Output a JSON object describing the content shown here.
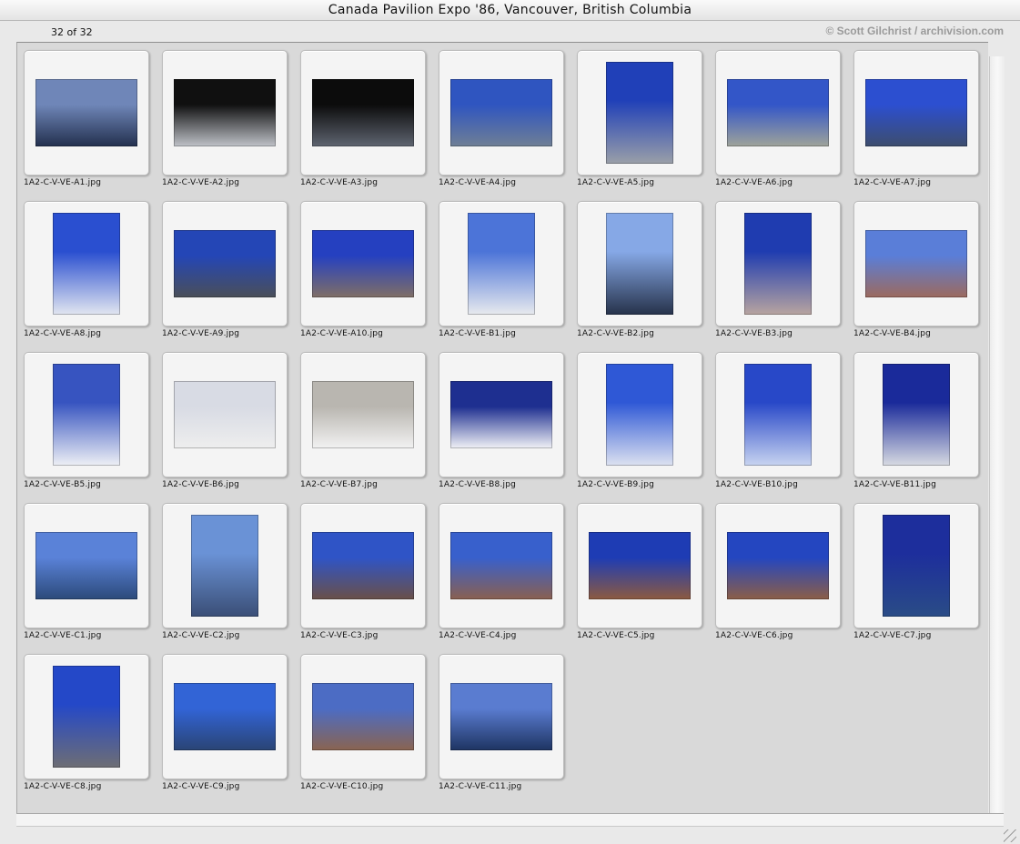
{
  "window": {
    "title": "Canada Pavilion Expo '86, Vancouver, British Columbia"
  },
  "header": {
    "count": "32 of 32",
    "copyright": "© Scott Gilchrist / archivision.com"
  },
  "thumbnails": [
    {
      "filename": "1A2-C-V-VE-A1.jpg",
      "orientation": "landscape",
      "top": "#6f86b8",
      "bottom": "#23304e"
    },
    {
      "filename": "1A2-C-V-VE-A2.jpg",
      "orientation": "landscape",
      "top": "#101010",
      "bottom": "#bfc2c8"
    },
    {
      "filename": "1A2-C-V-VE-A3.jpg",
      "orientation": "landscape",
      "top": "#0c0c0c",
      "bottom": "#5e6470"
    },
    {
      "filename": "1A2-C-V-VE-A4.jpg",
      "orientation": "landscape",
      "top": "#2f55c0",
      "bottom": "#6f7f95"
    },
    {
      "filename": "1A2-C-V-VE-A5.jpg",
      "orientation": "portrait",
      "top": "#2040b8",
      "bottom": "#9a9fa8"
    },
    {
      "filename": "1A2-C-V-VE-A6.jpg",
      "orientation": "landscape",
      "top": "#3356c8",
      "bottom": "#9fa39a"
    },
    {
      "filename": "1A2-C-V-VE-A7.jpg",
      "orientation": "landscape",
      "top": "#2c4fd0",
      "bottom": "#3d4d6d"
    },
    {
      "filename": "1A2-C-V-VE-A8.jpg",
      "orientation": "portrait",
      "top": "#2a4fd0",
      "bottom": "#e2e6f0"
    },
    {
      "filename": "1A2-C-V-VE-A9.jpg",
      "orientation": "landscape",
      "top": "#2446b6",
      "bottom": "#4a4f58"
    },
    {
      "filename": "1A2-C-V-VE-A10.jpg",
      "orientation": "landscape",
      "top": "#2540c0",
      "bottom": "#806f66"
    },
    {
      "filename": "1A2-C-V-VE-B1.jpg",
      "orientation": "portrait",
      "top": "#4c74d8",
      "bottom": "#e8eaee"
    },
    {
      "filename": "1A2-C-V-VE-B2.jpg",
      "orientation": "portrait",
      "top": "#86a8e6",
      "bottom": "#26324a"
    },
    {
      "filename": "1A2-C-V-VE-B3.jpg",
      "orientation": "portrait",
      "top": "#1f3cb0",
      "bottom": "#b8a4a0"
    },
    {
      "filename": "1A2-C-V-VE-B4.jpg",
      "orientation": "landscape",
      "top": "#5a7ed8",
      "bottom": "#9c6a5e"
    },
    {
      "filename": "1A2-C-V-VE-B5.jpg",
      "orientation": "portrait",
      "top": "#3754c0",
      "bottom": "#eef0f5"
    },
    {
      "filename": "1A2-C-V-VE-B6.jpg",
      "orientation": "landscape",
      "top": "#d8dbe4",
      "bottom": "#eeeeee"
    },
    {
      "filename": "1A2-C-V-VE-B7.jpg",
      "orientation": "landscape",
      "top": "#b9b6b0",
      "bottom": "#f2f2f2"
    },
    {
      "filename": "1A2-C-V-VE-B8.jpg",
      "orientation": "landscape",
      "top": "#1e2f90",
      "bottom": "#f0f1f6"
    },
    {
      "filename": "1A2-C-V-VE-B9.jpg",
      "orientation": "portrait",
      "top": "#2f58d6",
      "bottom": "#dde2f0"
    },
    {
      "filename": "1A2-C-V-VE-B10.jpg",
      "orientation": "portrait",
      "top": "#2848c8",
      "bottom": "#c8d4f0"
    },
    {
      "filename": "1A2-C-V-VE-B11.jpg",
      "orientation": "portrait",
      "top": "#1a2a9a",
      "bottom": "#d8dbe2"
    },
    {
      "filename": "1A2-C-V-VE-C1.jpg",
      "orientation": "landscape",
      "top": "#5a82d8",
      "bottom": "#2c4a7a"
    },
    {
      "filename": "1A2-C-V-VE-C2.jpg",
      "orientation": "portrait",
      "top": "#6a92d6",
      "bottom": "#3a4e76"
    },
    {
      "filename": "1A2-C-V-VE-C3.jpg",
      "orientation": "landscape",
      "top": "#2f54c6",
      "bottom": "#6a5048"
    },
    {
      "filename": "1A2-C-V-VE-C4.jpg",
      "orientation": "landscape",
      "top": "#3860cc",
      "bottom": "#8a6050"
    },
    {
      "filename": "1A2-C-V-VE-C5.jpg",
      "orientation": "landscape",
      "top": "#1e3cb4",
      "bottom": "#8c5a40"
    },
    {
      "filename": "1A2-C-V-VE-C6.jpg",
      "orientation": "landscape",
      "top": "#2446c0",
      "bottom": "#8c5e46"
    },
    {
      "filename": "1A2-C-V-VE-C7.jpg",
      "orientation": "portrait",
      "top": "#1d2e9c",
      "bottom": "#2a4c86"
    },
    {
      "filename": "1A2-C-V-VE-C8.jpg",
      "orientation": "portrait",
      "top": "#2448c8",
      "bottom": "#6e6e74"
    },
    {
      "filename": "1A2-C-V-VE-C9.jpg",
      "orientation": "landscape",
      "top": "#3264d6",
      "bottom": "#2a4474"
    },
    {
      "filename": "1A2-C-V-VE-C10.jpg",
      "orientation": "landscape",
      "top": "#4c6cc4",
      "bottom": "#8a6450"
    },
    {
      "filename": "1A2-C-V-VE-C11.jpg",
      "orientation": "landscape",
      "top": "#5a7cd0",
      "bottom": "#1e3462"
    }
  ]
}
